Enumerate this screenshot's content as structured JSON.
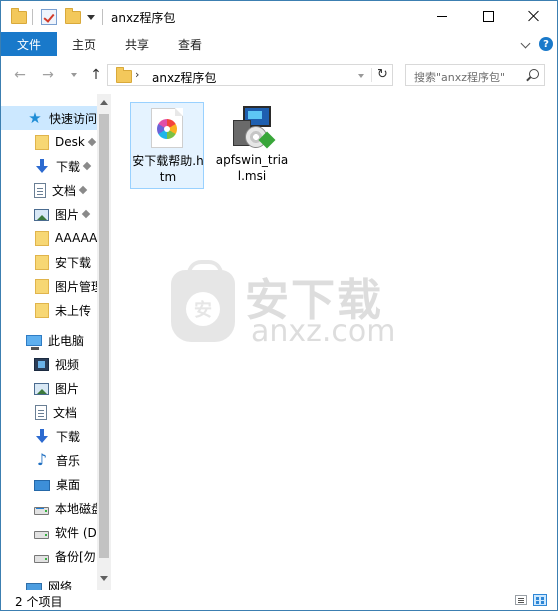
{
  "window": {
    "title": "anxz程序包"
  },
  "ribbon": {
    "tabs": [
      "文件",
      "主页",
      "共享",
      "查看"
    ],
    "help": "?"
  },
  "address": {
    "path": "anxz程序包",
    "separator": "›",
    "refresh": "↻"
  },
  "search": {
    "placeholder": "搜索\"anxz程序包\""
  },
  "nav": {
    "back": "←",
    "forward": "→",
    "up": "↑"
  },
  "sidebar": {
    "items": [
      {
        "label": "快速访问",
        "icon": "star-icon"
      },
      {
        "label": "Desk",
        "icon": "folder-icon",
        "pinned": true
      },
      {
        "label": "下载",
        "icon": "download-icon",
        "pinned": true
      },
      {
        "label": "文档",
        "icon": "document-icon",
        "pinned": true
      },
      {
        "label": "图片",
        "icon": "picture-icon",
        "pinned": true
      },
      {
        "label": "AAAAA",
        "icon": "folder-icon"
      },
      {
        "label": "安下载",
        "icon": "folder-icon"
      },
      {
        "label": "图片管理",
        "icon": "folder-icon"
      },
      {
        "label": "未上传",
        "icon": "folder-icon"
      },
      {
        "label": "此电脑",
        "icon": "computer-icon"
      },
      {
        "label": "视频",
        "icon": "video-icon"
      },
      {
        "label": "图片",
        "icon": "picture-icon"
      },
      {
        "label": "文档",
        "icon": "document-icon"
      },
      {
        "label": "下载",
        "icon": "download-icon"
      },
      {
        "label": "音乐",
        "icon": "music-icon"
      },
      {
        "label": "桌面",
        "icon": "desktop-icon"
      },
      {
        "label": "本地磁盘",
        "icon": "drive-icon"
      },
      {
        "label": "软件 (D",
        "icon": "drive-icon"
      },
      {
        "label": "备份[勿",
        "icon": "drive-icon"
      },
      {
        "label": "网络",
        "icon": "network-icon"
      }
    ]
  },
  "files": [
    {
      "name": "安下载帮助.htm",
      "icon": "htm-file-icon",
      "selected": true
    },
    {
      "name": "apfswin_trial.msi",
      "icon": "msi-installer-icon",
      "selected": false
    }
  ],
  "watermark": {
    "cn": "安下载",
    "en": "anxz.com",
    "badge": "安"
  },
  "status": {
    "count": "2 个项目"
  },
  "colors": {
    "accent": "#1979ca",
    "selection": "#cce8ff",
    "file_selection": "#e5f3ff"
  }
}
